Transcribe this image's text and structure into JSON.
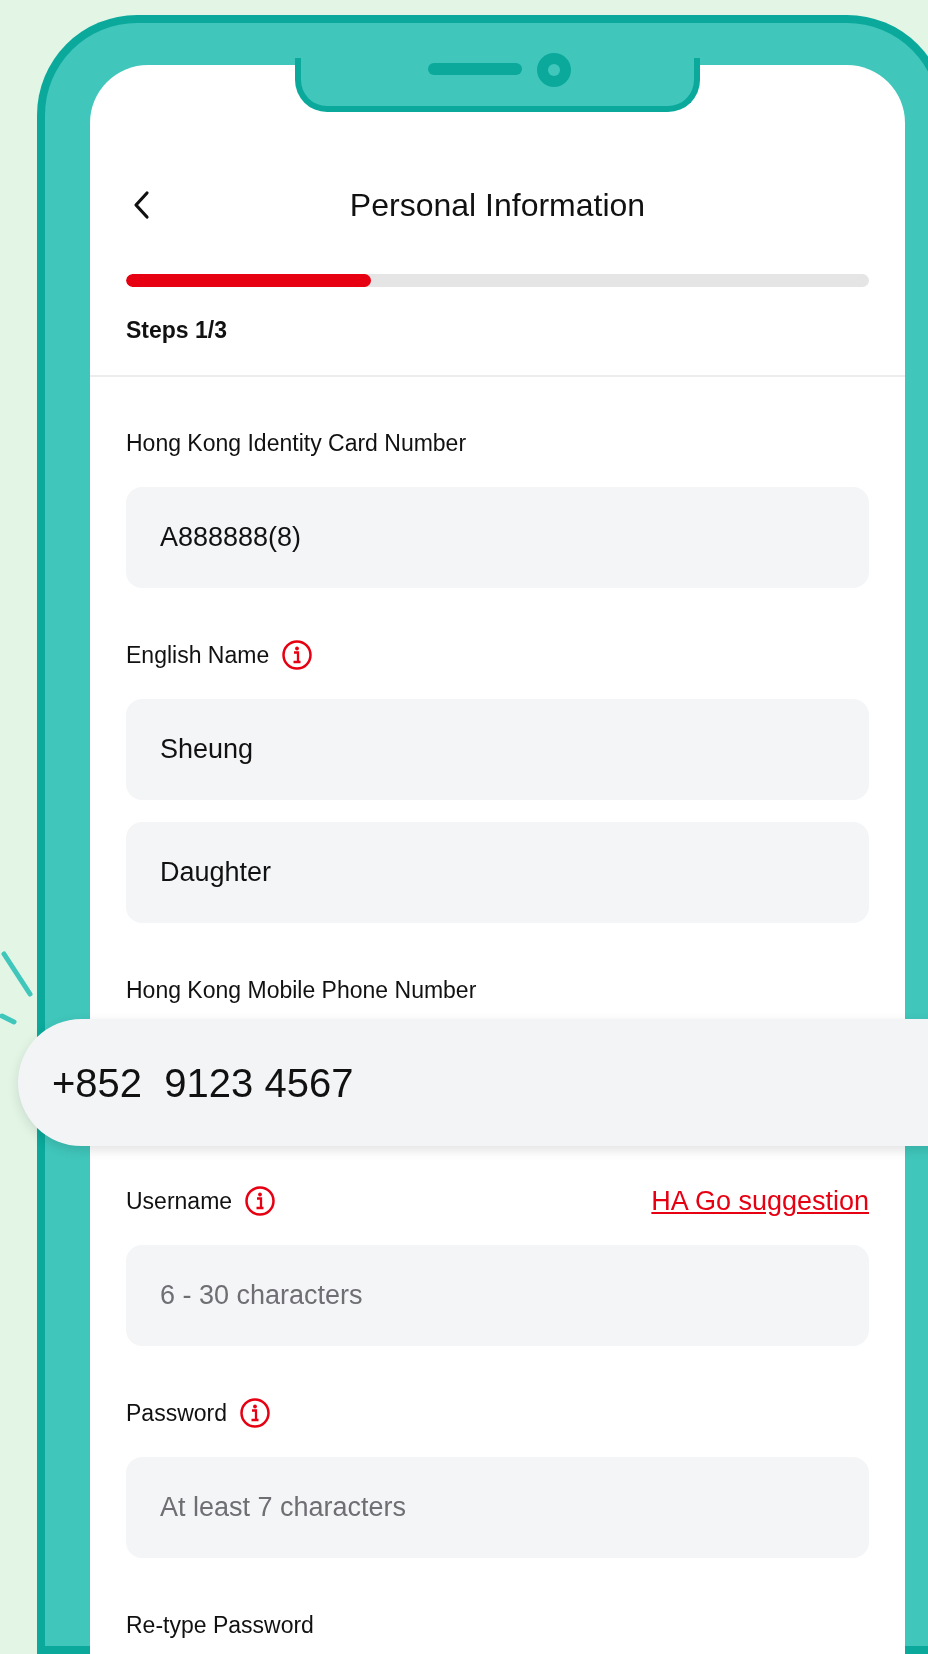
{
  "header": {
    "title": "Personal Information"
  },
  "progress": {
    "level": 0.33,
    "label": "Steps 1/3"
  },
  "fields": [
    {
      "kind": "text",
      "label": "Hong Kong Identity Card Number",
      "info": false,
      "inputs": [
        {
          "value": "A888888(8)"
        }
      ]
    },
    {
      "kind": "text",
      "label": "English Name",
      "info": true,
      "inputs": [
        {
          "value": "Sheung"
        },
        {
          "value": "Daughter"
        }
      ]
    },
    {
      "kind": "phone",
      "label": "Hong Kong Mobile Phone Number",
      "info": false,
      "inputs": [
        {
          "value": "+852  9123 4567"
        }
      ]
    },
    {
      "kind": "text",
      "label": "Username",
      "info": true,
      "link": "HA Go suggestion",
      "inputs": [
        {
          "placeholder": "6 - 30 characters"
        }
      ]
    },
    {
      "kind": "text",
      "label": "Password",
      "info": true,
      "inputs": [
        {
          "placeholder": "At least 7 characters"
        }
      ]
    },
    {
      "kind": "text",
      "label": "Re-type Password",
      "info": false
    }
  ]
}
